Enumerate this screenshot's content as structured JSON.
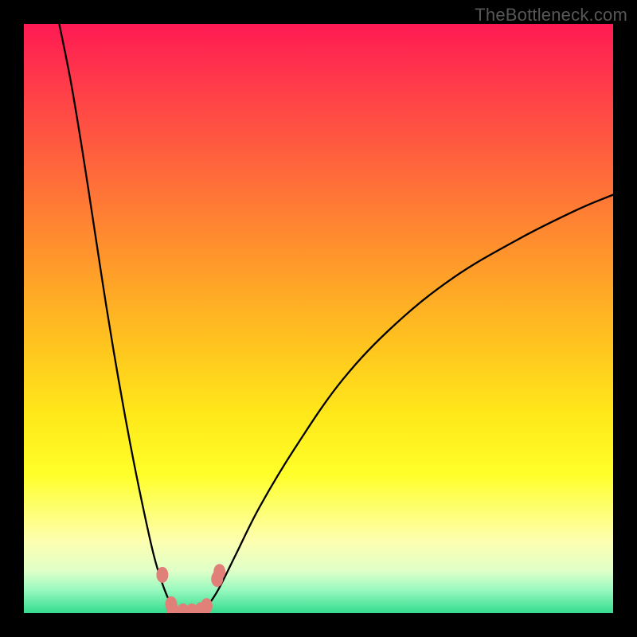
{
  "watermark": "TheBottleneck.com",
  "chart_data": {
    "type": "line",
    "title": "",
    "xlabel": "",
    "ylabel": "",
    "xlim": [
      0,
      100
    ],
    "ylim": [
      0,
      100
    ],
    "grid": false,
    "legend": false,
    "series": [
      {
        "name": "bottleneck-curve-left",
        "x": [
          6,
          8,
          10,
          12,
          14,
          16,
          18,
          20,
          22,
          23.5,
          25,
          26.5,
          27
        ],
        "y": [
          100,
          90,
          78,
          65,
          52,
          40,
          29,
          19,
          10,
          5,
          1.5,
          0.2,
          0
        ]
      },
      {
        "name": "bottleneck-curve-right",
        "x": [
          30,
          31,
          33,
          36,
          40,
          46,
          54,
          63,
          73,
          84,
          94,
          100
        ],
        "y": [
          0,
          1,
          4,
          10,
          18,
          28,
          39.5,
          49,
          57,
          63.5,
          68.5,
          71
        ]
      }
    ],
    "markers": {
      "name": "sample-points",
      "color": "#e18079",
      "points": [
        {
          "x": 23.5,
          "y": 6.5
        },
        {
          "x": 25.0,
          "y": 1.5
        },
        {
          "x": 25.2,
          "y": 0.6
        },
        {
          "x": 27.0,
          "y": 0.3
        },
        {
          "x": 28.5,
          "y": 0.3
        },
        {
          "x": 30.0,
          "y": 0.5
        },
        {
          "x": 31.0,
          "y": 1.2
        },
        {
          "x": 32.8,
          "y": 5.8
        },
        {
          "x": 33.2,
          "y": 7.0
        }
      ]
    },
    "gradient_stops": [
      {
        "pos": 0,
        "color": "#ff1a53"
      },
      {
        "pos": 25,
        "color": "#ff6a3a"
      },
      {
        "pos": 53,
        "color": "#ffc31f"
      },
      {
        "pos": 75,
        "color": "#ffff2a"
      },
      {
        "pos": 97,
        "color": "#4ee49b"
      },
      {
        "pos": 100,
        "color": "#0ccf79"
      }
    ]
  }
}
